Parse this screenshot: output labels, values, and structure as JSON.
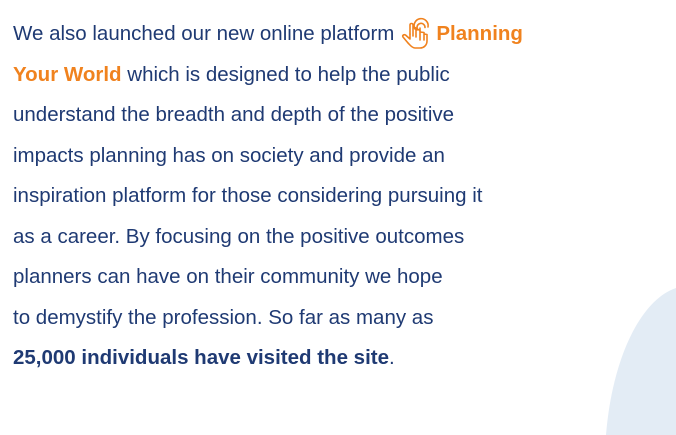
{
  "paragraph": {
    "line1_text": "We also launched our new online platform",
    "link_part1": "Planning",
    "link_part2": "Your World",
    "line2_rest": " which is designed to help the public",
    "line3": "understand the breadth and depth of the positive",
    "line4": "impacts planning has on society and provide an",
    "line5": "inspiration platform for those considering pursuing it",
    "line6": "as a career. By focusing on the positive outcomes",
    "line7": "planners can have on their community we hope",
    "line8": "to demystify the profession. So far as many as",
    "line9_bold": "25,000 individuals have visited the site",
    "line9_end": "."
  },
  "icons": {
    "pointer": "hand-pointer-icon"
  },
  "colors": {
    "text": "#1f3a73",
    "accent": "#f0821e",
    "deco_shape": "#e3ecf5"
  }
}
